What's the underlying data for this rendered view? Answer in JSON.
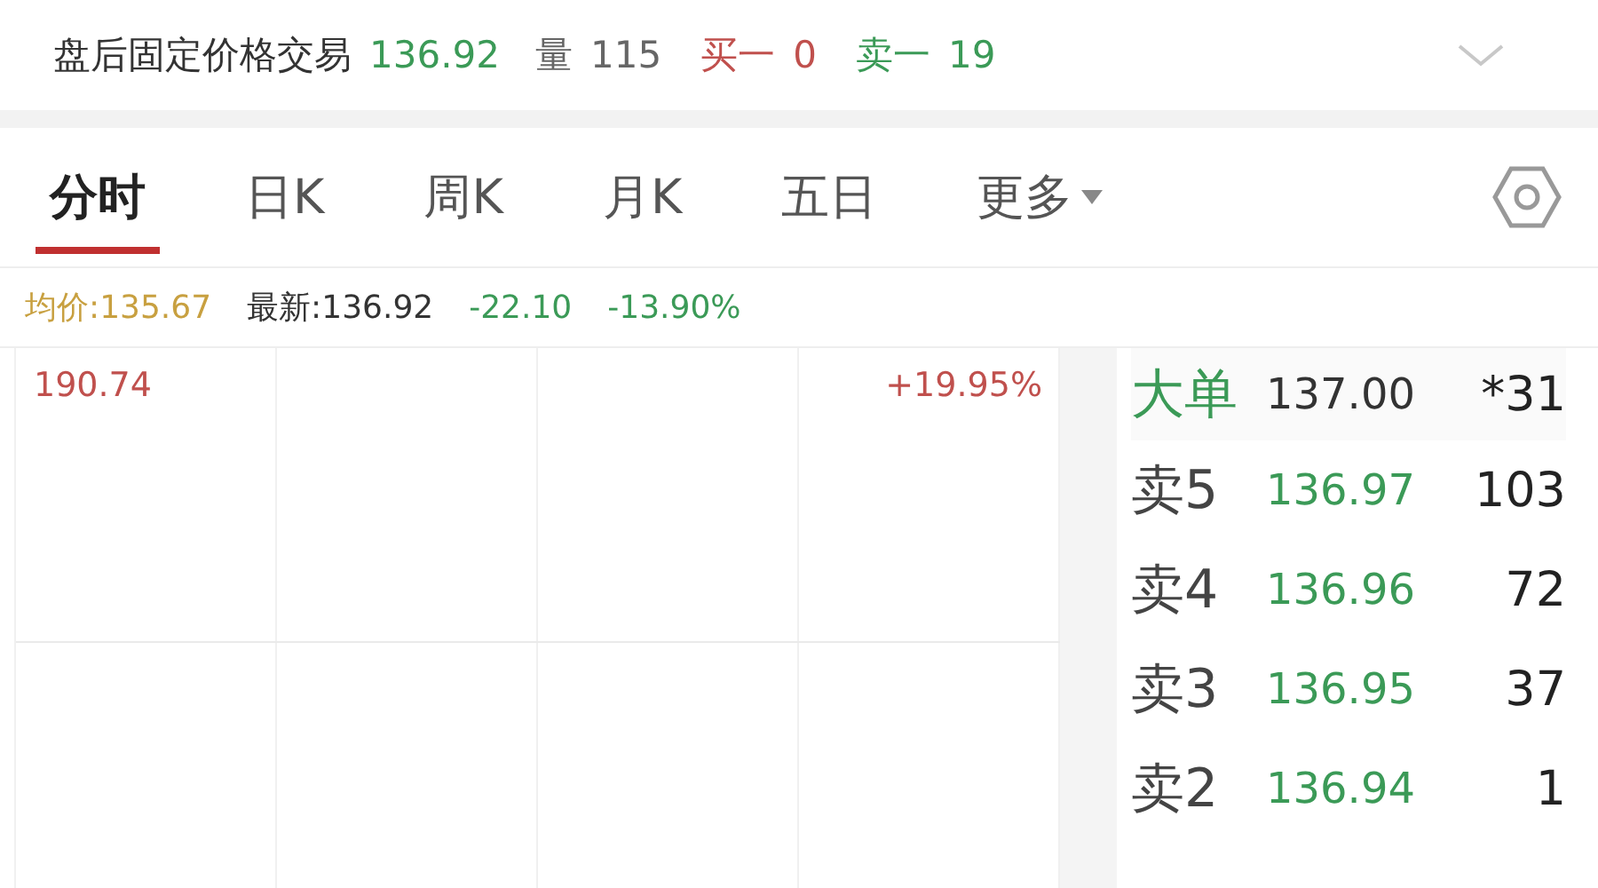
{
  "quote_bar": {
    "title": "盘后固定价格交易",
    "price": "136.92",
    "volume_label": "量",
    "volume": "115",
    "bid_label": "买一",
    "bid": "0",
    "ask_label": "卖一",
    "ask": "19"
  },
  "tabs": [
    {
      "label": "分时",
      "selected": true,
      "kind": "plain"
    },
    {
      "label": "日K",
      "selected": false,
      "kind": "plain"
    },
    {
      "label": "周K",
      "selected": false,
      "kind": "plain"
    },
    {
      "label": "月K",
      "selected": false,
      "kind": "plain"
    },
    {
      "label": "五日",
      "selected": false,
      "kind": "plain"
    },
    {
      "label": "更多",
      "selected": false,
      "kind": "dropdown"
    }
  ],
  "info_line": {
    "avg_label": "均价:",
    "avg": "135.67",
    "latest_label": "最新:",
    "latest": "136.92",
    "change": "-22.10",
    "change_pct": "-13.90%"
  },
  "chart": {
    "max_price": "190.74",
    "max_pct": "+19.95%"
  },
  "order_book": [
    {
      "kind": "big",
      "label": "大单",
      "price": "137.00",
      "volume": "*31"
    },
    {
      "kind": "ask",
      "label": "卖5",
      "price": "136.97",
      "volume": "103"
    },
    {
      "kind": "ask",
      "label": "卖4",
      "price": "136.96",
      "volume": "72"
    },
    {
      "kind": "ask",
      "label": "卖3",
      "price": "136.95",
      "volume": "37"
    },
    {
      "kind": "ask",
      "label": "卖2",
      "price": "136.94",
      "volume": "1"
    }
  ]
}
